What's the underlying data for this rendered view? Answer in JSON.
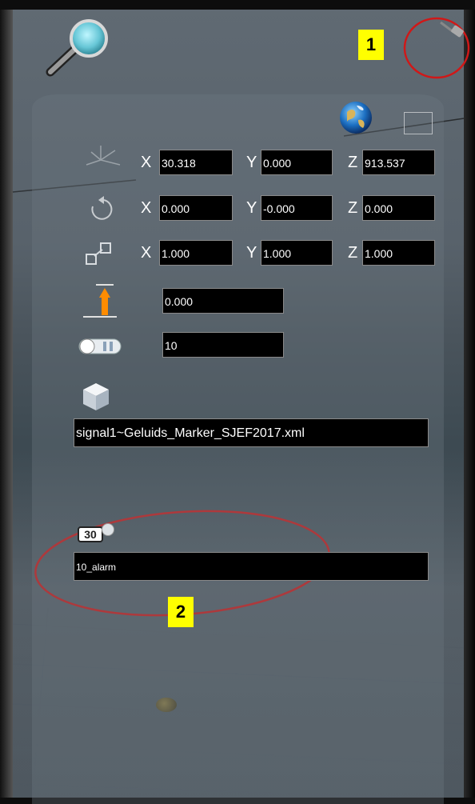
{
  "position": {
    "x": "30.318",
    "y": "0.000",
    "z": "913.537"
  },
  "rotation": {
    "x": "0.000",
    "y": "-0.000",
    "z": "0.000"
  },
  "scale": {
    "x": "1.000",
    "y": "1.000",
    "z": "1.000"
  },
  "axis_labels": {
    "x": "X",
    "y": "Y",
    "z": "Z"
  },
  "height_value": "0.000",
  "counter_value": "10",
  "object_file": "signal1~Geluids_Marker_SJEF2017.xml",
  "speed_icon_text": "30",
  "sound_value": "10_alarm",
  "annotations": {
    "badge1": "1",
    "badge2": "2"
  },
  "icons": {
    "search": "magnifier-icon",
    "pin": "pin-icon",
    "globe": "globe-icon",
    "position": "axes-icon",
    "rotation": "rotate-icon",
    "scale": "scale-icon",
    "height": "height-arrow-icon",
    "counter": "toggle-icon",
    "object": "cube-icon",
    "speed": "speed-sign-icon"
  }
}
